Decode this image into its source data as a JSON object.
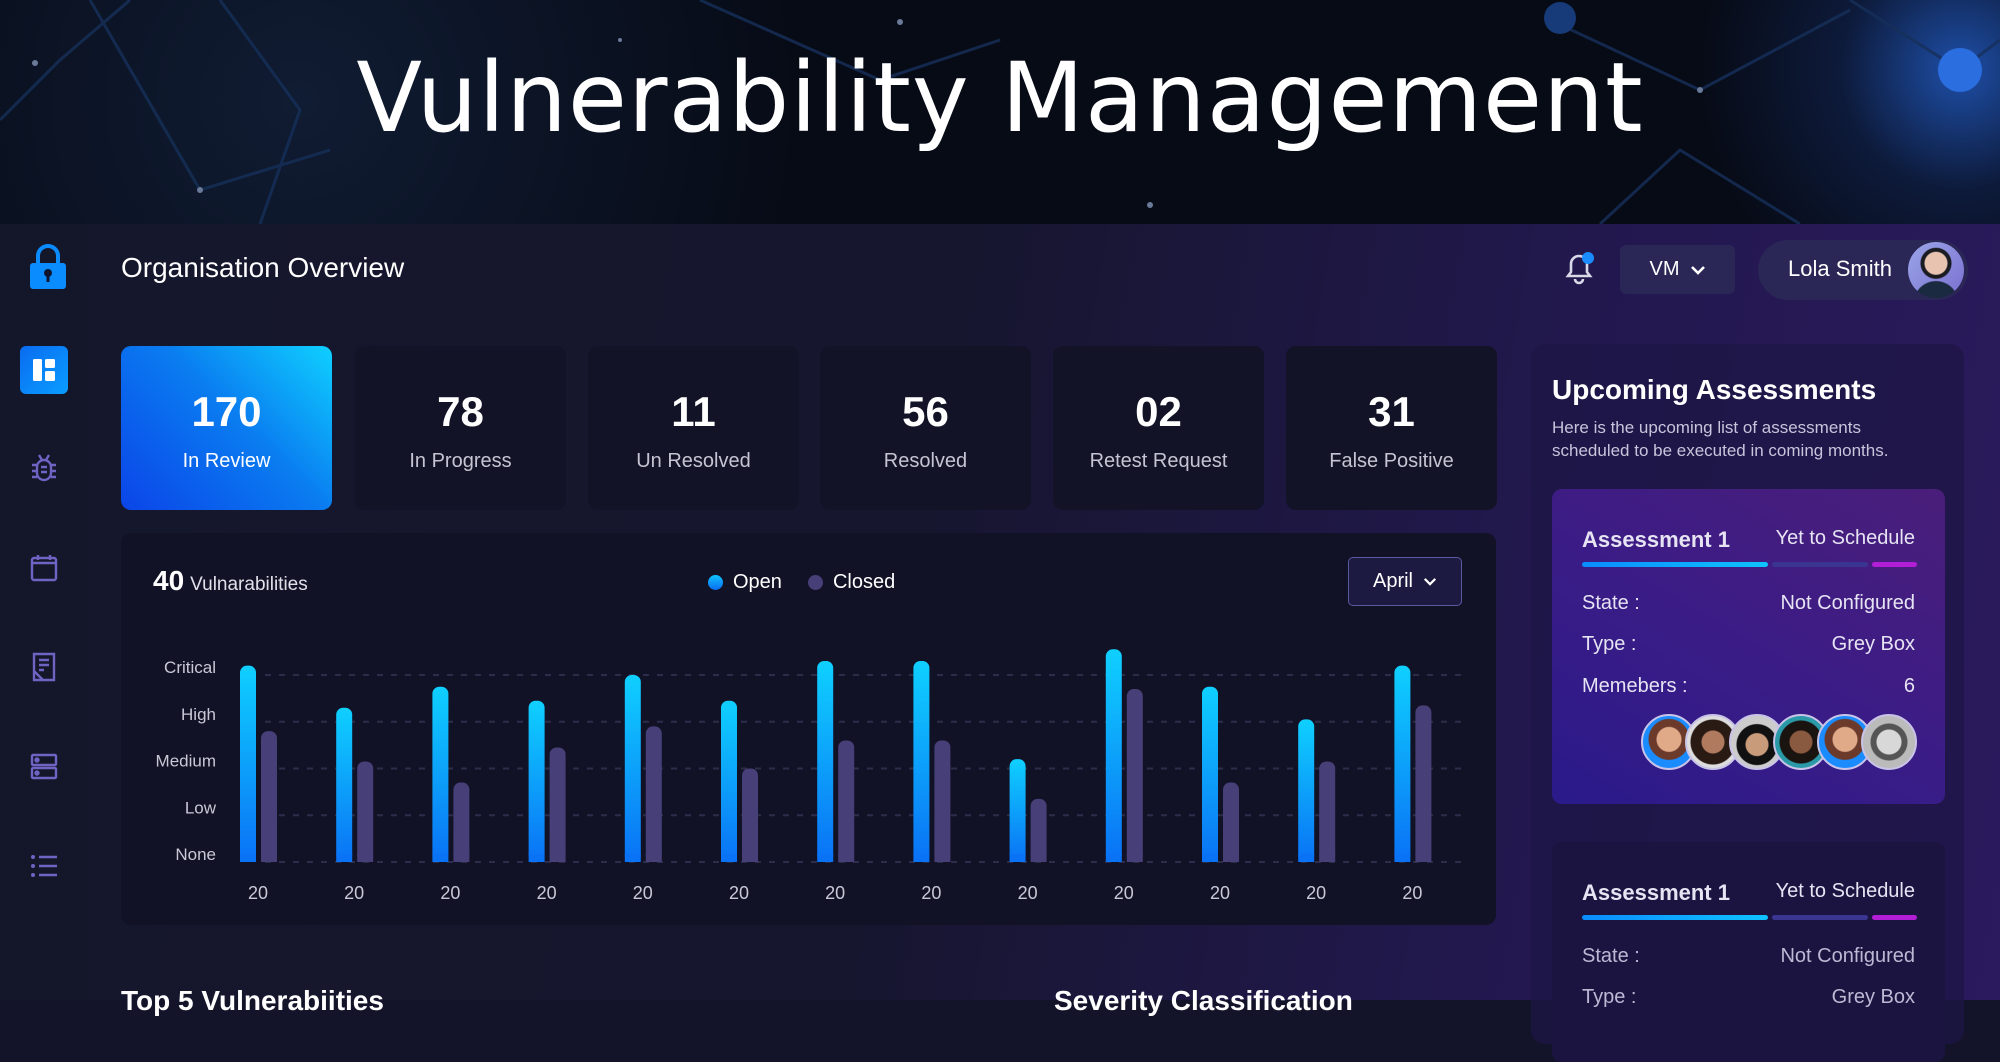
{
  "banner": {
    "title": "Vulnerability Management"
  },
  "topbar": {
    "title": "Organisation Overview",
    "workspace": "VM",
    "user_name": "Lola Smith"
  },
  "sidebar": {
    "items": [
      {
        "icon": "dashboard-icon",
        "active": true
      },
      {
        "icon": "bug-icon",
        "active": false
      },
      {
        "icon": "calendar-icon",
        "active": false
      },
      {
        "icon": "report-icon",
        "active": false
      },
      {
        "icon": "server-icon",
        "active": false
      },
      {
        "icon": "list-icon",
        "active": false
      }
    ]
  },
  "stats": [
    {
      "value": "170",
      "label": "In Review"
    },
    {
      "value": "78",
      "label": "In Progress"
    },
    {
      "value": "11",
      "label": "Un Resolved"
    },
    {
      "value": "56",
      "label": "Resolved"
    },
    {
      "value": "02",
      "label": "Retest Request"
    },
    {
      "value": "31",
      "label": "False Positive"
    }
  ],
  "chart_panel": {
    "count": "40",
    "count_label": "Vulnarabilities",
    "month": "April"
  },
  "chart_data": {
    "type": "bar",
    "categories": [
      "20",
      "20",
      "20",
      "20",
      "20",
      "20",
      "20",
      "20",
      "20",
      "20",
      "20",
      "20",
      "20"
    ],
    "y_tick_labels": [
      "None",
      "Low",
      "Medium",
      "High",
      "Critical"
    ],
    "ylim": [
      0,
      4.6
    ],
    "grid": true,
    "legend_placement": "top-center",
    "series": [
      {
        "name": "Open",
        "color": "#0aa8ff",
        "values": [
          4.2,
          3.3,
          3.75,
          3.45,
          4.0,
          3.45,
          4.3,
          4.3,
          2.2,
          4.55,
          3.75,
          3.05,
          4.2
        ]
      },
      {
        "name": "Closed",
        "color": "#463f78",
        "values": [
          2.8,
          2.15,
          1.7,
          2.45,
          2.9,
          2.0,
          2.6,
          2.6,
          1.35,
          3.7,
          1.7,
          2.15,
          3.35
        ]
      }
    ]
  },
  "assessments": {
    "title": "Upcoming Assessments",
    "description_lines": [
      "Here is the upcoming list of assessments",
      "scheduled to be executed in coming months."
    ],
    "cards": [
      {
        "name": "Assessment 1",
        "status": "Yet to Schedule",
        "state_label": "State :",
        "state": "Not Configured",
        "type_label": "Type :",
        "type": "Grey Box",
        "members_label": "Memebers :",
        "members": "6"
      },
      {
        "name": "Assessment 1",
        "status": "Yet to Schedule",
        "state_label": "State :",
        "state": "Not Configured",
        "type_label": "Type :",
        "type": "Grey Box"
      }
    ]
  },
  "bottom": {
    "top5_title": "Top 5 Vulnerabiities",
    "severity_title": "Severity Classification"
  },
  "colors": {
    "accent": "#0a8cff",
    "sidebar_icon": "#6f63c4",
    "notification_dot": "#1a8cff"
  }
}
